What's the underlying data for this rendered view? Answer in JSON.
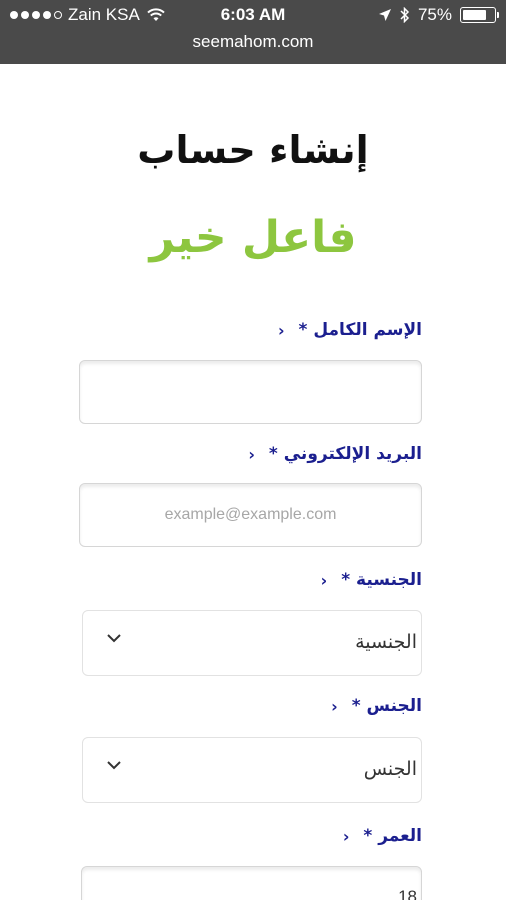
{
  "status_bar": {
    "carrier": "Zain KSA",
    "time": "6:03 AM",
    "battery": "75%",
    "battery_level": 0.75
  },
  "browser": {
    "url": "seemahom.com"
  },
  "header": {
    "title": "إنشاء حساب",
    "brand": "فاعل خير"
  },
  "form": {
    "full_name_label": "الإسم الكامل *",
    "full_name_value": "",
    "email_label": "البريد الإلكتروني *",
    "email_placeholder": "example@example.com",
    "nationality_label": "الجنسية *",
    "nationality_value": "الجنسية",
    "gender_label": "الجنس *",
    "gender_value": "الجنس",
    "age_label": "العمر *",
    "age_value": "18"
  },
  "colors": {
    "brand_green": "#8dc63f",
    "label_blue": "#1b1f8f",
    "status_bar": "#4a4a4a"
  }
}
